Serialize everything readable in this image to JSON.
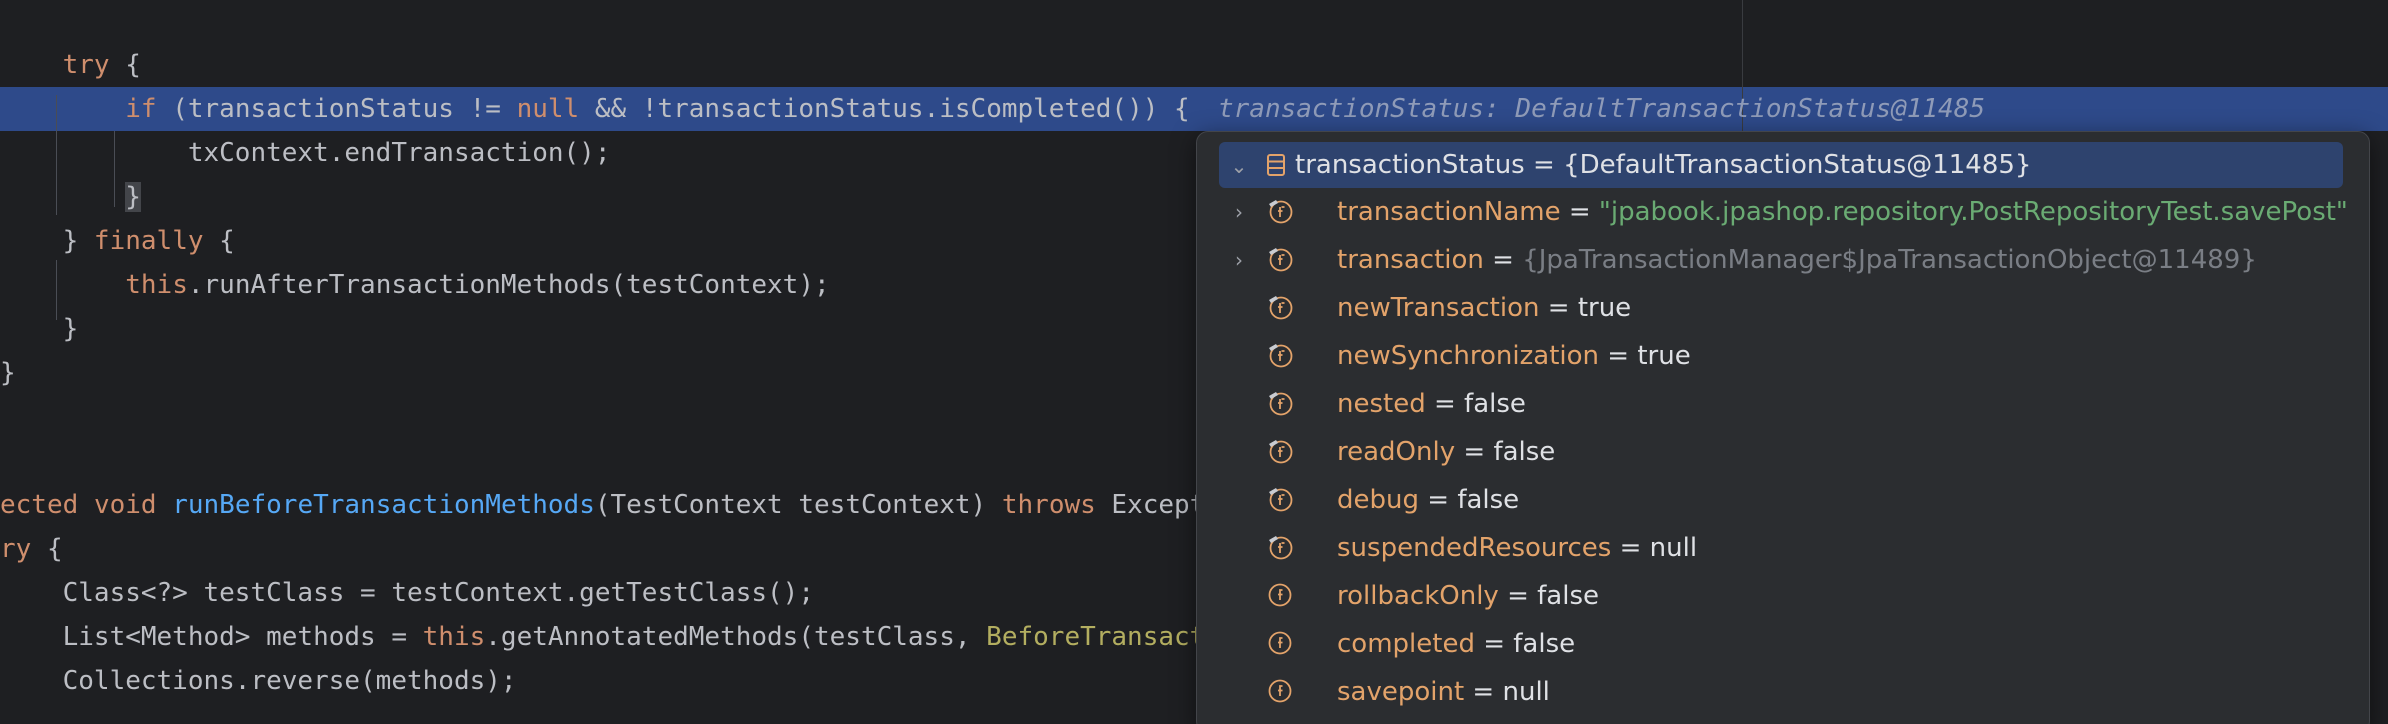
{
  "editor": {
    "lines": [
      {
        "id": "try-open",
        "segments": [
          {
            "t": "    "
          },
          {
            "t": "try",
            "c": "kw"
          },
          {
            "t": " {"
          }
        ]
      },
      {
        "id": "if-cond",
        "segments": [
          {
            "t": "        "
          },
          {
            "t": "if",
            "c": "kw"
          },
          {
            "t": " (transactionStatus != "
          },
          {
            "t": "null",
            "c": "kw"
          },
          {
            "t": " && !transactionStatus.isCompleted()) {"
          }
        ]
      },
      {
        "id": "end-tx",
        "segments": [
          {
            "t": "            txContext.endTransaction();"
          }
        ]
      },
      {
        "id": "if-close",
        "segments": [
          {
            "t": "        "
          },
          {
            "t": "}",
            "c": "brace-hl"
          }
        ]
      },
      {
        "id": "finally",
        "segments": [
          {
            "t": "    } "
          },
          {
            "t": "finally",
            "c": "kw"
          },
          {
            "t": " {"
          }
        ]
      },
      {
        "id": "run-after",
        "segments": [
          {
            "t": "        "
          },
          {
            "t": "this",
            "c": "kw"
          },
          {
            "t": ".runAfterTransactionMethods(testContext);"
          }
        ]
      },
      {
        "id": "finally-close",
        "segments": [
          {
            "t": "    }"
          }
        ]
      },
      {
        "id": "method-close",
        "segments": [
          {
            "t": "}"
          }
        ]
      },
      {
        "id": "blank-1",
        "segments": [
          {
            "t": ""
          }
        ]
      },
      {
        "id": "blank-2",
        "segments": [
          {
            "t": ""
          }
        ]
      },
      {
        "id": "method-decl",
        "segments": [
          {
            "t": "ected",
            "c": "kw"
          },
          {
            "t": " "
          },
          {
            "t": "void",
            "c": "kw"
          },
          {
            "t": " "
          },
          {
            "t": "runBeforeTransactionMethods",
            "c": "fn"
          },
          {
            "t": "(TestContext testContext) "
          },
          {
            "t": "throws",
            "c": "kw"
          },
          {
            "t": " Except"
          }
        ]
      },
      {
        "id": "try-2",
        "segments": [
          {
            "t": "ry",
            "c": "kw"
          },
          {
            "t": " {"
          }
        ]
      },
      {
        "id": "class-line",
        "segments": [
          {
            "t": "    Class<?> testClass = testContext.getTestClass();"
          }
        ]
      },
      {
        "id": "list-line",
        "segments": [
          {
            "t": "    List<Method> methods = "
          },
          {
            "t": "this",
            "c": "kw"
          },
          {
            "t": ".getAnnotatedMethods(testClass, "
          },
          {
            "t": "BeforeTransact",
            "c": "ann"
          }
        ]
      },
      {
        "id": "reverse-line",
        "segments": [
          {
            "t": "    Collections.reverse(methods);"
          }
        ]
      }
    ],
    "inline_hint": "transactionStatus: DefaultTransactionStatus@11485"
  },
  "debug_popup": {
    "root": {
      "name": "transactionStatus",
      "eq": " = ",
      "value": "{DefaultTransactionStatus@11485}"
    },
    "fields": [
      {
        "name": "transactionName",
        "eq": " = ",
        "value": "\"jpabook.jpashop.repository.PostRepositoryTest.savePost\"",
        "vc": "str",
        "expandable": true,
        "icon": "field-inherited-icon"
      },
      {
        "name": "transaction",
        "eq": " = ",
        "value": "{JpaTransactionManager$JpaTransactionObject@11489}",
        "vc": "dim",
        "expandable": true,
        "icon": "field-inherited-icon"
      },
      {
        "name": "newTransaction",
        "eq": " = ",
        "value": "true",
        "vc": "eq",
        "expandable": false,
        "icon": "field-inherited-icon"
      },
      {
        "name": "newSynchronization",
        "eq": " = ",
        "value": "true",
        "vc": "eq",
        "expandable": false,
        "icon": "field-inherited-icon"
      },
      {
        "name": "nested",
        "eq": " = ",
        "value": "false",
        "vc": "eq",
        "expandable": false,
        "icon": "field-inherited-icon"
      },
      {
        "name": "readOnly",
        "eq": " = ",
        "value": "false",
        "vc": "eq",
        "expandable": false,
        "icon": "field-inherited-icon"
      },
      {
        "name": "debug",
        "eq": " = ",
        "value": "false",
        "vc": "eq",
        "expandable": false,
        "icon": "field-inherited-icon"
      },
      {
        "name": "suspendedResources",
        "eq": " = ",
        "value": "null",
        "vc": "eq",
        "expandable": false,
        "icon": "field-inherited-icon"
      },
      {
        "name": "rollbackOnly",
        "eq": " = ",
        "value": "false",
        "vc": "eq",
        "expandable": false,
        "icon": "field-icon"
      },
      {
        "name": "completed",
        "eq": " = ",
        "value": "false",
        "vc": "eq",
        "expandable": false,
        "icon": "field-icon"
      },
      {
        "name": "savepoint",
        "eq": " = ",
        "value": "null",
        "vc": "eq",
        "expandable": false,
        "icon": "field-icon"
      }
    ]
  },
  "colors": {
    "background": "#1e1f22",
    "highlight_row": "#2e4a8a",
    "keyword": "#cf8e6d",
    "method": "#56a8f5",
    "string": "#6aab73",
    "field_name": "#e3a36a"
  }
}
